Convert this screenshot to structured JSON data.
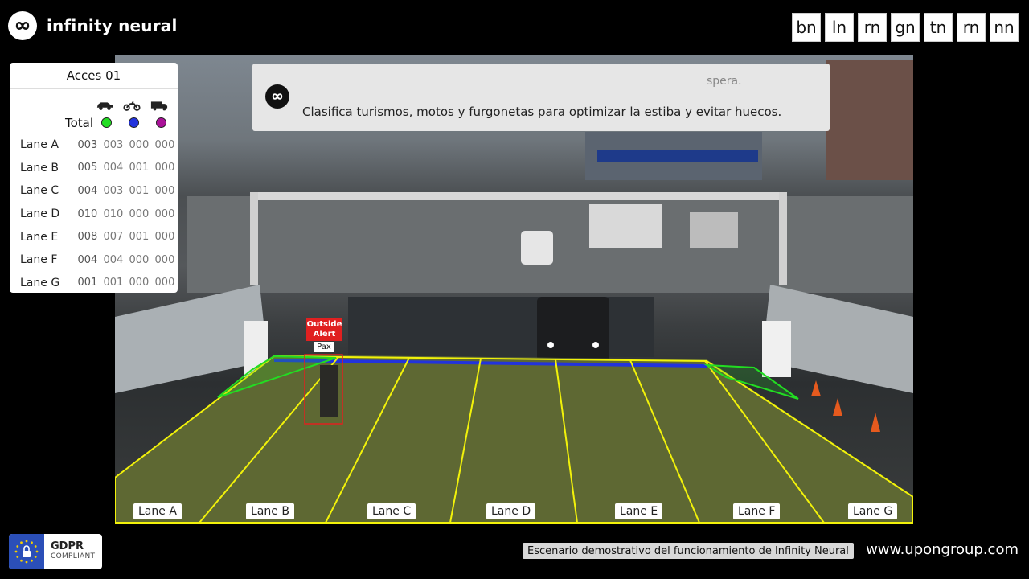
{
  "brand": {
    "name": "infinity neural",
    "logo_icon": "infinity-logo-icon"
  },
  "top_tabs": [
    "bn",
    "ln",
    "rn",
    "gn",
    "tn",
    "rn",
    "nn"
  ],
  "panel": {
    "title": "Acces 01",
    "icons": [
      "car-icon",
      "motorbike-icon",
      "van-icon"
    ],
    "total_label": "Total",
    "dot_colors": [
      "#22dd22",
      "#2233dd",
      "#aa1199"
    ],
    "rows": [
      {
        "lane": "Lane A",
        "total": "003",
        "cars": "003",
        "motos": "000",
        "vans": "000"
      },
      {
        "lane": "Lane B",
        "total": "005",
        "cars": "004",
        "motos": "001",
        "vans": "000"
      },
      {
        "lane": "Lane C",
        "total": "004",
        "cars": "003",
        "motos": "001",
        "vans": "000"
      },
      {
        "lane": "Lane D",
        "total": "010",
        "cars": "010",
        "motos": "000",
        "vans": "000"
      },
      {
        "lane": "Lane E",
        "total": "008",
        "cars": "007",
        "motos": "001",
        "vans": "000"
      },
      {
        "lane": "Lane F",
        "total": "004",
        "cars": "004",
        "motos": "000",
        "vans": "000"
      },
      {
        "lane": "Lane G",
        "total": "001",
        "cars": "001",
        "motos": "000",
        "vans": "000"
      }
    ]
  },
  "banner": {
    "faded_text": "spera.",
    "text": "Clasifica turismos, motos y furgonetas para optimizar la estiba y evitar huecos."
  },
  "lanes": [
    "Lane A",
    "Lane B",
    "Lane C",
    "Lane D",
    "Lane E",
    "Lane F",
    "Lane G"
  ],
  "alert": {
    "label_line1": "Outside",
    "label_line2": "Alert",
    "tag": "Pax",
    "color": "#e02020"
  },
  "colors": {
    "lane_line": "#f2f20a",
    "zone_green": "#22dd22",
    "ramp_blue": "#2233dd"
  },
  "footer": {
    "gdpr_title": "GDPR",
    "gdpr_sub": "COMPLIANT",
    "caption": "Escenario demostrativo del funcionamiento de Infinity Neural",
    "website": "www.upongroup.com"
  }
}
